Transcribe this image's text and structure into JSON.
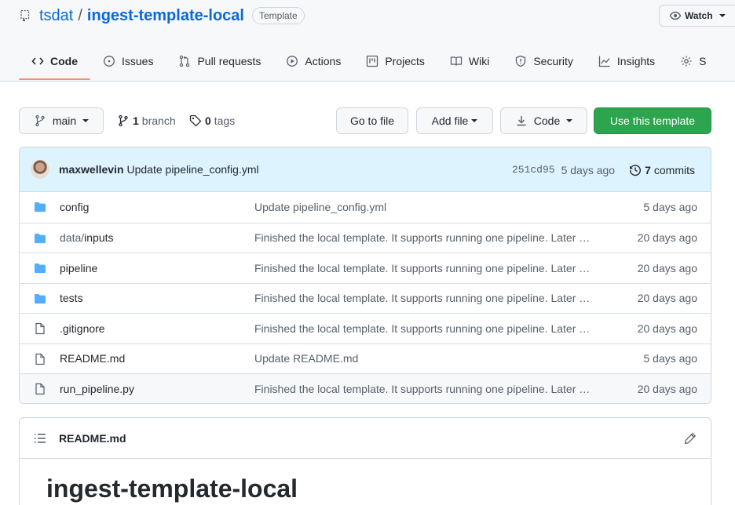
{
  "repo": {
    "owner": "tsdat",
    "separator": "/",
    "name": "ingest-template-local",
    "badge": "Template",
    "watch_label": "Watch"
  },
  "tabs": [
    {
      "label": "Code",
      "icon": "code-icon",
      "active": true
    },
    {
      "label": "Issues",
      "icon": "issue-icon"
    },
    {
      "label": "Pull requests",
      "icon": "pull-request-icon"
    },
    {
      "label": "Actions",
      "icon": "play-icon"
    },
    {
      "label": "Projects",
      "icon": "project-icon"
    },
    {
      "label": "Wiki",
      "icon": "book-icon"
    },
    {
      "label": "Security",
      "icon": "shield-icon"
    },
    {
      "label": "Insights",
      "icon": "graph-icon"
    },
    {
      "label": "S",
      "icon": "gear-icon"
    }
  ],
  "toolbar": {
    "branch": "main",
    "branch_count": "1",
    "branch_label": "branch",
    "tag_count": "0",
    "tag_label": "tags",
    "go_to_file": "Go to file",
    "add_file": "Add file",
    "code": "Code",
    "use_template": "Use this template"
  },
  "latest_commit": {
    "author": "maxwellevin",
    "message": "Update pipeline_config.yml",
    "sha": "251cd95",
    "age": "5 days ago",
    "commit_count": "7",
    "commit_label": "commits"
  },
  "files": [
    {
      "type": "dir",
      "name": "config",
      "message": "Update pipeline_config.yml",
      "age": "5 days ago"
    },
    {
      "type": "dir",
      "name_prefix": "data/",
      "name": "inputs",
      "message": "Finished the local template. It supports running one pipeline. Later …",
      "age": "20 days ago"
    },
    {
      "type": "dir",
      "name": "pipeline",
      "message": "Finished the local template. It supports running one pipeline. Later …",
      "age": "20 days ago"
    },
    {
      "type": "dir",
      "name": "tests",
      "message": "Finished the local template. It supports running one pipeline. Later …",
      "age": "20 days ago"
    },
    {
      "type": "file",
      "name": ".gitignore",
      "message": "Finished the local template. It supports running one pipeline. Later …",
      "age": "20 days ago"
    },
    {
      "type": "file",
      "name": "README.md",
      "message": "Update README.md",
      "age": "5 days ago"
    },
    {
      "type": "file",
      "name": "run_pipeline.py",
      "message": "Finished the local template. It supports running one pipeline. Later …",
      "age": "20 days ago"
    }
  ],
  "readme": {
    "filename": "README.md",
    "heading": "ingest-template-local"
  },
  "colors": {
    "link": "#0969da",
    "green": "#2da44e",
    "folder": "#54aeff",
    "commit_bar": "#ddf4ff",
    "tab_underline": "#fd8c73"
  }
}
